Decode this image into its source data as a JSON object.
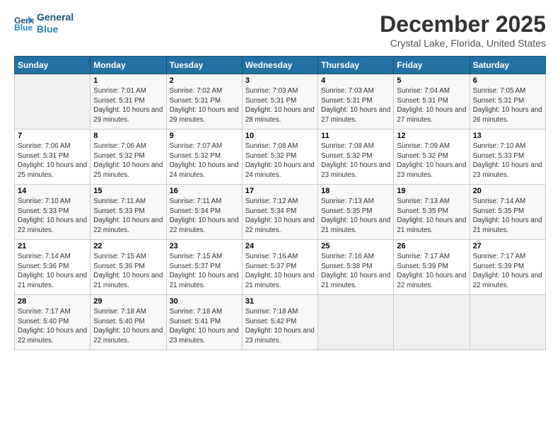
{
  "logo": {
    "line1": "General",
    "line2": "Blue"
  },
  "title": "December 2025",
  "location": "Crystal Lake, Florida, United States",
  "days_of_week": [
    "Sunday",
    "Monday",
    "Tuesday",
    "Wednesday",
    "Thursday",
    "Friday",
    "Saturday"
  ],
  "weeks": [
    [
      {
        "day": "",
        "sunrise": "",
        "sunset": "",
        "daylight": ""
      },
      {
        "day": "1",
        "sunrise": "Sunrise: 7:01 AM",
        "sunset": "Sunset: 5:31 PM",
        "daylight": "Daylight: 10 hours and 29 minutes."
      },
      {
        "day": "2",
        "sunrise": "Sunrise: 7:02 AM",
        "sunset": "Sunset: 5:31 PM",
        "daylight": "Daylight: 10 hours and 29 minutes."
      },
      {
        "day": "3",
        "sunrise": "Sunrise: 7:03 AM",
        "sunset": "Sunset: 5:31 PM",
        "daylight": "Daylight: 10 hours and 28 minutes."
      },
      {
        "day": "4",
        "sunrise": "Sunrise: 7:03 AM",
        "sunset": "Sunset: 5:31 PM",
        "daylight": "Daylight: 10 hours and 27 minutes."
      },
      {
        "day": "5",
        "sunrise": "Sunrise: 7:04 AM",
        "sunset": "Sunset: 5:31 PM",
        "daylight": "Daylight: 10 hours and 27 minutes."
      },
      {
        "day": "6",
        "sunrise": "Sunrise: 7:05 AM",
        "sunset": "Sunset: 5:31 PM",
        "daylight": "Daylight: 10 hours and 26 minutes."
      }
    ],
    [
      {
        "day": "7",
        "sunrise": "Sunrise: 7:06 AM",
        "sunset": "Sunset: 5:31 PM",
        "daylight": "Daylight: 10 hours and 25 minutes."
      },
      {
        "day": "8",
        "sunrise": "Sunrise: 7:06 AM",
        "sunset": "Sunset: 5:32 PM",
        "daylight": "Daylight: 10 hours and 25 minutes."
      },
      {
        "day": "9",
        "sunrise": "Sunrise: 7:07 AM",
        "sunset": "Sunset: 5:32 PM",
        "daylight": "Daylight: 10 hours and 24 minutes."
      },
      {
        "day": "10",
        "sunrise": "Sunrise: 7:08 AM",
        "sunset": "Sunset: 5:32 PM",
        "daylight": "Daylight: 10 hours and 24 minutes."
      },
      {
        "day": "11",
        "sunrise": "Sunrise: 7:08 AM",
        "sunset": "Sunset: 5:32 PM",
        "daylight": "Daylight: 10 hours and 23 minutes."
      },
      {
        "day": "12",
        "sunrise": "Sunrise: 7:09 AM",
        "sunset": "Sunset: 5:32 PM",
        "daylight": "Daylight: 10 hours and 23 minutes."
      },
      {
        "day": "13",
        "sunrise": "Sunrise: 7:10 AM",
        "sunset": "Sunset: 5:33 PM",
        "daylight": "Daylight: 10 hours and 23 minutes."
      }
    ],
    [
      {
        "day": "14",
        "sunrise": "Sunrise: 7:10 AM",
        "sunset": "Sunset: 5:33 PM",
        "daylight": "Daylight: 10 hours and 22 minutes."
      },
      {
        "day": "15",
        "sunrise": "Sunrise: 7:11 AM",
        "sunset": "Sunset: 5:33 PM",
        "daylight": "Daylight: 10 hours and 22 minutes."
      },
      {
        "day": "16",
        "sunrise": "Sunrise: 7:11 AM",
        "sunset": "Sunset: 5:34 PM",
        "daylight": "Daylight: 10 hours and 22 minutes."
      },
      {
        "day": "17",
        "sunrise": "Sunrise: 7:12 AM",
        "sunset": "Sunset: 5:34 PM",
        "daylight": "Daylight: 10 hours and 22 minutes."
      },
      {
        "day": "18",
        "sunrise": "Sunrise: 7:13 AM",
        "sunset": "Sunset: 5:35 PM",
        "daylight": "Daylight: 10 hours and 21 minutes."
      },
      {
        "day": "19",
        "sunrise": "Sunrise: 7:13 AM",
        "sunset": "Sunset: 5:35 PM",
        "daylight": "Daylight: 10 hours and 21 minutes."
      },
      {
        "day": "20",
        "sunrise": "Sunrise: 7:14 AM",
        "sunset": "Sunset: 5:35 PM",
        "daylight": "Daylight: 10 hours and 21 minutes."
      }
    ],
    [
      {
        "day": "21",
        "sunrise": "Sunrise: 7:14 AM",
        "sunset": "Sunset: 5:36 PM",
        "daylight": "Daylight: 10 hours and 21 minutes."
      },
      {
        "day": "22",
        "sunrise": "Sunrise: 7:15 AM",
        "sunset": "Sunset: 5:36 PM",
        "daylight": "Daylight: 10 hours and 21 minutes."
      },
      {
        "day": "23",
        "sunrise": "Sunrise: 7:15 AM",
        "sunset": "Sunset: 5:37 PM",
        "daylight": "Daylight: 10 hours and 21 minutes."
      },
      {
        "day": "24",
        "sunrise": "Sunrise: 7:16 AM",
        "sunset": "Sunset: 5:37 PM",
        "daylight": "Daylight: 10 hours and 21 minutes."
      },
      {
        "day": "25",
        "sunrise": "Sunrise: 7:16 AM",
        "sunset": "Sunset: 5:38 PM",
        "daylight": "Daylight: 10 hours and 21 minutes."
      },
      {
        "day": "26",
        "sunrise": "Sunrise: 7:17 AM",
        "sunset": "Sunset: 5:39 PM",
        "daylight": "Daylight: 10 hours and 22 minutes."
      },
      {
        "day": "27",
        "sunrise": "Sunrise: 7:17 AM",
        "sunset": "Sunset: 5:39 PM",
        "daylight": "Daylight: 10 hours and 22 minutes."
      }
    ],
    [
      {
        "day": "28",
        "sunrise": "Sunrise: 7:17 AM",
        "sunset": "Sunset: 5:40 PM",
        "daylight": "Daylight: 10 hours and 22 minutes."
      },
      {
        "day": "29",
        "sunrise": "Sunrise: 7:18 AM",
        "sunset": "Sunset: 5:40 PM",
        "daylight": "Daylight: 10 hours and 22 minutes."
      },
      {
        "day": "30",
        "sunrise": "Sunrise: 7:18 AM",
        "sunset": "Sunset: 5:41 PM",
        "daylight": "Daylight: 10 hours and 23 minutes."
      },
      {
        "day": "31",
        "sunrise": "Sunrise: 7:18 AM",
        "sunset": "Sunset: 5:42 PM",
        "daylight": "Daylight: 10 hours and 23 minutes."
      },
      {
        "day": "",
        "sunrise": "",
        "sunset": "",
        "daylight": ""
      },
      {
        "day": "",
        "sunrise": "",
        "sunset": "",
        "daylight": ""
      },
      {
        "day": "",
        "sunrise": "",
        "sunset": "",
        "daylight": ""
      }
    ]
  ]
}
